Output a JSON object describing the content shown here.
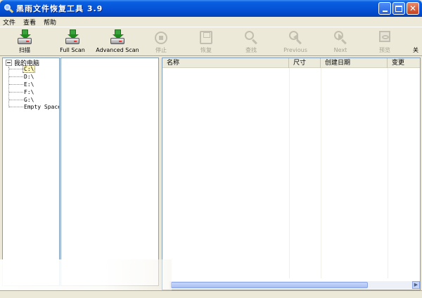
{
  "window": {
    "title": "黑雨文件恢复工具 3.9"
  },
  "menu": [
    "文件",
    "查看",
    "帮助"
  ],
  "toolbar": {
    "scan": "扫描",
    "full_scan": "Full Scan",
    "advanced_scan": "Advanced Scan",
    "stop": "停止",
    "recover": "恢复",
    "find": "查找",
    "previous": "Previous",
    "next": "Next",
    "preview": "预览",
    "overflow": "关"
  },
  "tree": {
    "root": "我的电脑",
    "items": [
      "C:\\",
      "D:\\",
      "E:\\",
      "F:\\",
      "G:\\",
      "Empty Space"
    ]
  },
  "list": {
    "columns": [
      "名称",
      "尺寸",
      "创建日期",
      "变更"
    ]
  },
  "colors": {
    "title_bar": "#0654d8",
    "window_bg": "#ece9d8",
    "pane_border": "#7f9db9"
  }
}
